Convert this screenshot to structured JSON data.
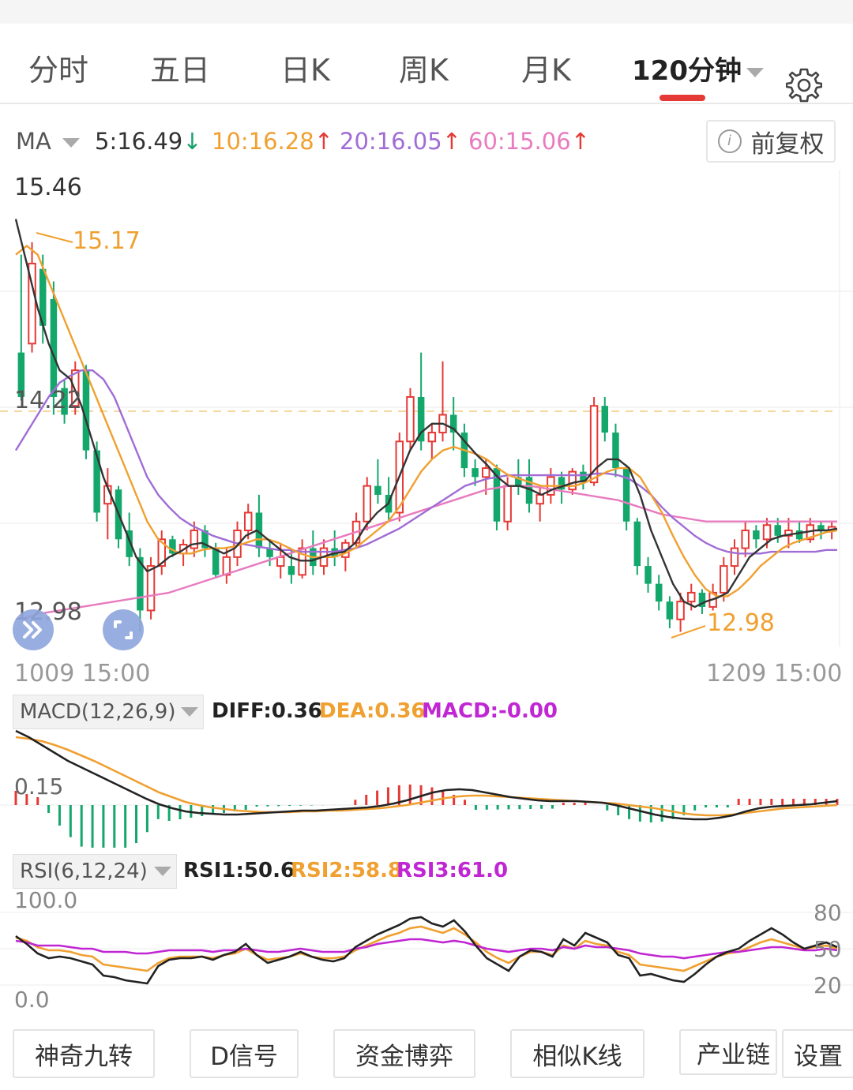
{
  "tabs": [
    {
      "label": "分时",
      "active": false
    },
    {
      "label": "五日",
      "active": false
    },
    {
      "label": "日K",
      "active": false
    },
    {
      "label": "周K",
      "active": false
    },
    {
      "label": "月K",
      "active": false
    },
    {
      "label": "120分钟",
      "active": true
    }
  ],
  "ma": {
    "label": "MA",
    "ma5": "5:16.49",
    "ma10": "10:16.28",
    "ma20": "20:16.05",
    "ma60": "60:15.06",
    "arrow_down": "↓",
    "arrow_up": "↑",
    "colors": {
      "ma5": "#333333",
      "ma10": "#f0a030",
      "ma20": "#a06cd5",
      "ma60": "#e87bbf"
    }
  },
  "adjust_button": {
    "icon": "i",
    "label": "前复权"
  },
  "price_labels": {
    "high": "15.46",
    "peak_ma": "15.17",
    "mid": "14.22",
    "low_left": "12.98",
    "low_right": "12.98"
  },
  "date_axis": {
    "start": "1009 15:00",
    "end": "1209 15:00"
  },
  "macd": {
    "selector": "MACD(12,26,9)",
    "diff": "DIFF:0.36",
    "dea": "DEA:0.36",
    "macd": "MACD:-0.00",
    "scale_label": "0.15"
  },
  "rsi": {
    "selector": "RSI(6,12,24)",
    "rsi1": "RSI1:50.6",
    "rsi2": "RSI2:58.8",
    "rsi3": "RSI3:61.0",
    "top": "100.0",
    "bottom": "0.0",
    "r80": "80",
    "r50": "50",
    "r20": "20"
  },
  "bottom_buttons": [
    "神奇九转",
    "D信号",
    "资金博弈",
    "相似K线",
    "产业链",
    "设置"
  ],
  "chart_data": {
    "type": "candlestick",
    "ylim": [
      12.98,
      15.46
    ],
    "reference_line": 14.22,
    "candles": [
      {
        "o": 14.3,
        "h": 15.1,
        "l": 14.28,
        "c": 14.55,
        "up": false
      },
      {
        "o": 14.6,
        "h": 15.17,
        "l": 14.55,
        "c": 15.05,
        "up": true
      },
      {
        "o": 15.02,
        "h": 15.1,
        "l": 14.6,
        "c": 14.7,
        "up": false
      },
      {
        "o": 14.85,
        "h": 14.95,
        "l": 14.2,
        "c": 14.3,
        "up": false
      },
      {
        "o": 14.35,
        "h": 14.4,
        "l": 14.15,
        "c": 14.2,
        "up": false
      },
      {
        "o": 14.25,
        "h": 14.5,
        "l": 14.2,
        "c": 14.45,
        "up": true
      },
      {
        "o": 14.45,
        "h": 14.48,
        "l": 13.95,
        "c": 14.0,
        "up": false
      },
      {
        "o": 14.0,
        "h": 14.05,
        "l": 13.6,
        "c": 13.65,
        "up": false
      },
      {
        "o": 13.7,
        "h": 13.9,
        "l": 13.5,
        "c": 13.8,
        "up": true
      },
      {
        "o": 13.78,
        "h": 13.8,
        "l": 13.45,
        "c": 13.5,
        "up": false
      },
      {
        "o": 13.55,
        "h": 13.65,
        "l": 13.35,
        "c": 13.4,
        "up": false
      },
      {
        "o": 13.4,
        "h": 13.45,
        "l": 12.98,
        "c": 13.1,
        "up": false
      },
      {
        "o": 13.1,
        "h": 13.4,
        "l": 13.05,
        "c": 13.35,
        "up": true
      },
      {
        "o": 13.35,
        "h": 13.55,
        "l": 13.3,
        "c": 13.5,
        "up": true
      },
      {
        "o": 13.5,
        "h": 13.52,
        "l": 13.4,
        "c": 13.42,
        "up": false
      },
      {
        "o": 13.42,
        "h": 13.5,
        "l": 13.35,
        "c": 13.47,
        "up": true
      },
      {
        "o": 13.45,
        "h": 13.6,
        "l": 13.4,
        "c": 13.55,
        "up": true
      },
      {
        "o": 13.55,
        "h": 13.58,
        "l": 13.4,
        "c": 13.45,
        "up": false
      },
      {
        "o": 13.45,
        "h": 13.48,
        "l": 13.28,
        "c": 13.3,
        "up": false
      },
      {
        "o": 13.3,
        "h": 13.45,
        "l": 13.25,
        "c": 13.4,
        "up": true
      },
      {
        "o": 13.4,
        "h": 13.6,
        "l": 13.35,
        "c": 13.55,
        "up": true
      },
      {
        "o": 13.55,
        "h": 13.7,
        "l": 13.5,
        "c": 13.65,
        "up": true
      },
      {
        "o": 13.65,
        "h": 13.75,
        "l": 13.4,
        "c": 13.45,
        "up": false
      },
      {
        "o": 13.45,
        "h": 13.5,
        "l": 13.35,
        "c": 13.4,
        "up": false
      },
      {
        "o": 13.4,
        "h": 13.48,
        "l": 13.28,
        "c": 13.35,
        "up": true
      },
      {
        "o": 13.35,
        "h": 13.45,
        "l": 13.25,
        "c": 13.3,
        "up": false
      },
      {
        "o": 13.3,
        "h": 13.5,
        "l": 13.28,
        "c": 13.45,
        "up": true
      },
      {
        "o": 13.45,
        "h": 13.55,
        "l": 13.3,
        "c": 13.35,
        "up": false
      },
      {
        "o": 13.35,
        "h": 13.5,
        "l": 13.3,
        "c": 13.45,
        "up": true
      },
      {
        "o": 13.45,
        "h": 13.55,
        "l": 13.35,
        "c": 13.4,
        "up": false
      },
      {
        "o": 13.4,
        "h": 13.5,
        "l": 13.32,
        "c": 13.48,
        "up": true
      },
      {
        "o": 13.48,
        "h": 13.65,
        "l": 13.45,
        "c": 13.6,
        "up": true
      },
      {
        "o": 13.6,
        "h": 13.85,
        "l": 13.55,
        "c": 13.8,
        "up": true
      },
      {
        "o": 13.8,
        "h": 13.95,
        "l": 13.7,
        "c": 13.75,
        "up": false
      },
      {
        "o": 13.75,
        "h": 13.85,
        "l": 13.6,
        "c": 13.65,
        "up": false
      },
      {
        "o": 13.65,
        "h": 14.1,
        "l": 13.6,
        "c": 14.05,
        "up": true
      },
      {
        "o": 14.05,
        "h": 14.35,
        "l": 14.0,
        "c": 14.3,
        "up": true
      },
      {
        "o": 14.3,
        "h": 14.55,
        "l": 14.0,
        "c": 14.05,
        "up": false
      },
      {
        "o": 14.05,
        "h": 14.15,
        "l": 13.95,
        "c": 14.1,
        "up": true
      },
      {
        "o": 14.1,
        "h": 14.5,
        "l": 14.05,
        "c": 14.2,
        "up": true
      },
      {
        "o": 14.2,
        "h": 14.3,
        "l": 14.0,
        "c": 14.1,
        "up": false
      },
      {
        "o": 14.1,
        "h": 14.15,
        "l": 13.85,
        "c": 13.9,
        "up": false
      },
      {
        "o": 13.9,
        "h": 13.95,
        "l": 13.8,
        "c": 13.85,
        "up": false
      },
      {
        "o": 13.85,
        "h": 13.95,
        "l": 13.75,
        "c": 13.9,
        "up": true
      },
      {
        "o": 13.9,
        "h": 13.92,
        "l": 13.55,
        "c": 13.6,
        "up": false
      },
      {
        "o": 13.6,
        "h": 13.85,
        "l": 13.55,
        "c": 13.8,
        "up": true
      },
      {
        "o": 13.8,
        "h": 13.95,
        "l": 13.75,
        "c": 13.85,
        "up": false
      },
      {
        "o": 13.85,
        "h": 13.95,
        "l": 13.65,
        "c": 13.7,
        "up": false
      },
      {
        "o": 13.7,
        "h": 13.8,
        "l": 13.6,
        "c": 13.75,
        "up": true
      },
      {
        "o": 13.75,
        "h": 13.9,
        "l": 13.7,
        "c": 13.85,
        "up": true
      },
      {
        "o": 13.85,
        "h": 13.88,
        "l": 13.7,
        "c": 13.78,
        "up": false
      },
      {
        "o": 13.78,
        "h": 13.9,
        "l": 13.75,
        "c": 13.88,
        "up": true
      },
      {
        "o": 13.88,
        "h": 13.92,
        "l": 13.78,
        "c": 13.82,
        "up": false
      },
      {
        "o": 13.82,
        "h": 14.3,
        "l": 13.8,
        "c": 14.25,
        "up": true
      },
      {
        "o": 14.25,
        "h": 14.3,
        "l": 14.05,
        "c": 14.1,
        "up": false
      },
      {
        "o": 14.1,
        "h": 14.15,
        "l": 13.85,
        "c": 13.9,
        "up": false
      },
      {
        "o": 13.9,
        "h": 13.92,
        "l": 13.55,
        "c": 13.6,
        "up": false
      },
      {
        "o": 13.6,
        "h": 13.62,
        "l": 13.3,
        "c": 13.35,
        "up": false
      },
      {
        "o": 13.35,
        "h": 13.4,
        "l": 13.2,
        "c": 13.25,
        "up": false
      },
      {
        "o": 13.25,
        "h": 13.3,
        "l": 13.1,
        "c": 13.15,
        "up": false
      },
      {
        "o": 13.15,
        "h": 13.18,
        "l": 13.0,
        "c": 13.05,
        "up": false
      },
      {
        "o": 13.05,
        "h": 13.2,
        "l": 12.98,
        "c": 13.15,
        "up": true
      },
      {
        "o": 13.15,
        "h": 13.25,
        "l": 13.1,
        "c": 13.2,
        "up": true
      },
      {
        "o": 13.2,
        "h": 13.22,
        "l": 13.08,
        "c": 13.12,
        "up": false
      },
      {
        "o": 13.12,
        "h": 13.25,
        "l": 13.1,
        "c": 13.2,
        "up": true
      },
      {
        "o": 13.2,
        "h": 13.4,
        "l": 13.15,
        "c": 13.35,
        "up": true
      },
      {
        "o": 13.35,
        "h": 13.5,
        "l": 13.3,
        "c": 13.45,
        "up": true
      },
      {
        "o": 13.45,
        "h": 13.6,
        "l": 13.4,
        "c": 13.55,
        "up": true
      },
      {
        "o": 13.55,
        "h": 13.58,
        "l": 13.45,
        "c": 13.5,
        "up": false
      },
      {
        "o": 13.5,
        "h": 13.62,
        "l": 13.45,
        "c": 13.58,
        "up": true
      },
      {
        "o": 13.58,
        "h": 13.62,
        "l": 13.48,
        "c": 13.52,
        "up": false
      },
      {
        "o": 13.52,
        "h": 13.62,
        "l": 13.45,
        "c": 13.55,
        "up": true
      },
      {
        "o": 13.55,
        "h": 13.6,
        "l": 13.48,
        "c": 13.5,
        "up": false
      },
      {
        "o": 13.5,
        "h": 13.62,
        "l": 13.48,
        "c": 13.58,
        "up": true
      },
      {
        "o": 13.58,
        "h": 13.6,
        "l": 13.5,
        "c": 13.55,
        "up": false
      },
      {
        "o": 13.55,
        "h": 13.6,
        "l": 13.5,
        "c": 13.57,
        "up": true
      }
    ],
    "ma_lines": {
      "ma5": [
        15.3,
        15.05,
        14.8,
        14.6,
        14.45,
        14.4,
        14.25,
        14.05,
        13.85,
        13.7,
        13.55,
        13.4,
        13.32,
        13.35,
        13.4,
        13.43,
        13.47,
        13.48,
        13.45,
        13.42,
        13.45,
        13.52,
        13.55,
        13.5,
        13.45,
        13.4,
        13.38,
        13.38,
        13.4,
        13.42,
        13.43,
        13.48,
        13.58,
        13.65,
        13.7,
        13.85,
        14.0,
        14.1,
        14.15,
        14.15,
        14.12,
        14.05,
        13.98,
        13.92,
        13.85,
        13.8,
        13.8,
        13.78,
        13.75,
        13.78,
        13.8,
        13.82,
        13.83,
        13.9,
        13.95,
        13.95,
        13.9,
        13.75,
        13.55,
        13.4,
        13.25,
        13.15,
        13.12,
        13.15,
        13.17,
        13.2,
        13.3,
        13.4,
        13.45,
        13.5,
        13.52,
        13.53,
        13.54,
        13.55,
        13.55,
        13.56
      ],
      "ma10": [
        15.1,
        15.15,
        15.1,
        14.95,
        14.8,
        14.65,
        14.5,
        14.35,
        14.2,
        14.05,
        13.9,
        13.75,
        13.6,
        13.5,
        13.45,
        13.42,
        13.42,
        13.44,
        13.45,
        13.45,
        13.46,
        13.48,
        13.5,
        13.5,
        13.48,
        13.45,
        13.42,
        13.4,
        13.4,
        13.4,
        13.42,
        13.45,
        13.5,
        13.55,
        13.6,
        13.68,
        13.78,
        13.88,
        13.95,
        14.0,
        14.02,
        14.0,
        13.98,
        13.95,
        13.9,
        13.86,
        13.84,
        13.82,
        13.8,
        13.8,
        13.8,
        13.8,
        13.82,
        13.85,
        13.88,
        13.9,
        13.9,
        13.85,
        13.75,
        13.65,
        13.52,
        13.4,
        13.3,
        13.22,
        13.18,
        13.18,
        13.22,
        13.28,
        13.35,
        13.4,
        13.45,
        13.48,
        13.5,
        13.52,
        13.54,
        13.55
      ],
      "ma20": [
        14.0,
        14.1,
        14.2,
        14.3,
        14.38,
        14.42,
        14.45,
        14.45,
        14.4,
        14.3,
        14.15,
        14.0,
        13.85,
        13.75,
        13.68,
        13.62,
        13.58,
        13.55,
        13.52,
        13.5,
        13.48,
        13.47,
        13.46,
        13.45,
        13.44,
        13.44,
        13.43,
        13.43,
        13.43,
        13.43,
        13.44,
        13.45,
        13.47,
        13.5,
        13.53,
        13.56,
        13.6,
        13.64,
        13.68,
        13.72,
        13.76,
        13.8,
        13.82,
        13.84,
        13.85,
        13.86,
        13.86,
        13.86,
        13.86,
        13.86,
        13.86,
        13.86,
        13.86,
        13.87,
        13.87,
        13.86,
        13.84,
        13.8,
        13.75,
        13.68,
        13.62,
        13.57,
        13.52,
        13.48,
        13.45,
        13.43,
        13.42,
        13.42,
        13.42,
        13.43,
        13.43,
        13.43,
        13.43,
        13.43,
        13.44,
        13.44
      ],
      "ma60": [
        13.05,
        13.06,
        13.08,
        13.09,
        13.1,
        13.11,
        13.12,
        13.13,
        13.14,
        13.15,
        13.16,
        13.17,
        13.18,
        13.19,
        13.2,
        13.22,
        13.24,
        13.26,
        13.28,
        13.3,
        13.32,
        13.34,
        13.36,
        13.38,
        13.4,
        13.42,
        13.44,
        13.46,
        13.48,
        13.5,
        13.52,
        13.54,
        13.56,
        13.58,
        13.6,
        13.62,
        13.64,
        13.66,
        13.68,
        13.7,
        13.72,
        13.74,
        13.76,
        13.78,
        13.79,
        13.8,
        13.8,
        13.8,
        13.79,
        13.78,
        13.77,
        13.76,
        13.75,
        13.74,
        13.73,
        13.72,
        13.7,
        13.68,
        13.66,
        13.64,
        13.63,
        13.62,
        13.61,
        13.6,
        13.6,
        13.6,
        13.6,
        13.6,
        13.6,
        13.6,
        13.6,
        13.6,
        13.6,
        13.6,
        13.6,
        13.6
      ]
    }
  }
}
